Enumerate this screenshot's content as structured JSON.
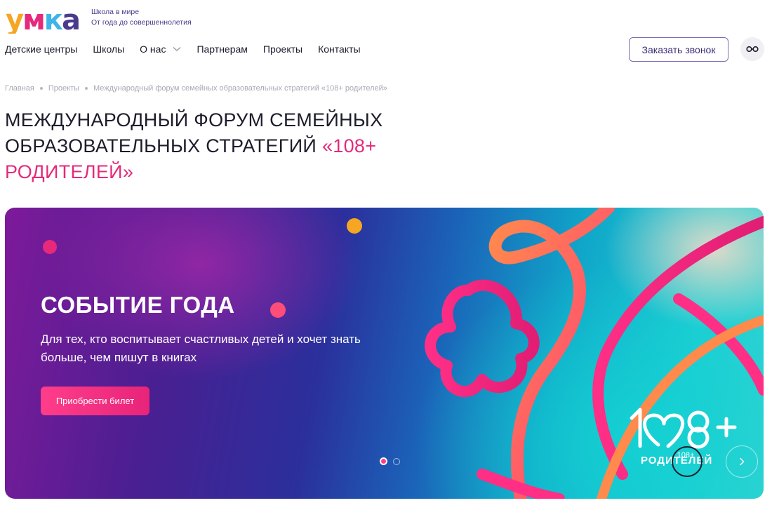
{
  "header": {
    "logo_text": "умка",
    "tagline_line1": "Школа в мире",
    "tagline_line2": "От года до совершеннолетия",
    "nav": [
      {
        "label": "Детские центры"
      },
      {
        "label": "Школы"
      },
      {
        "label": "О нас",
        "has_dropdown": true
      },
      {
        "label": "Партнерам"
      },
      {
        "label": "Проекты"
      },
      {
        "label": "Контакты"
      }
    ],
    "call_button": "Заказать звонок",
    "accessibility_icon": "glasses-icon"
  },
  "breadcrumb": [
    "Главная",
    "Проекты",
    "Международный форум семейных образовательных стратегий «108+ родителей»"
  ],
  "page_title": {
    "main": "Международный форум семейных образовательных стратегий",
    "accent": "«108+ родителей»"
  },
  "banner": {
    "title": "СОБЫТИЕ ГОДА",
    "subtitle": "Для тех, кто воспитывает счастливых детей и хочет знать больше, чем пишут в книгах",
    "ticket_button": "Приобрести билет",
    "slides_total": 2,
    "active_slide": 1,
    "brand_number": "108+",
    "brand_word": "РОДИТЕЛЕЙ",
    "next_icon": "chevron-right-icon"
  },
  "colors": {
    "accent_pink": "#e6297a",
    "brand_purple": "#4b3a8c",
    "text_dark": "#1c1c2b"
  }
}
